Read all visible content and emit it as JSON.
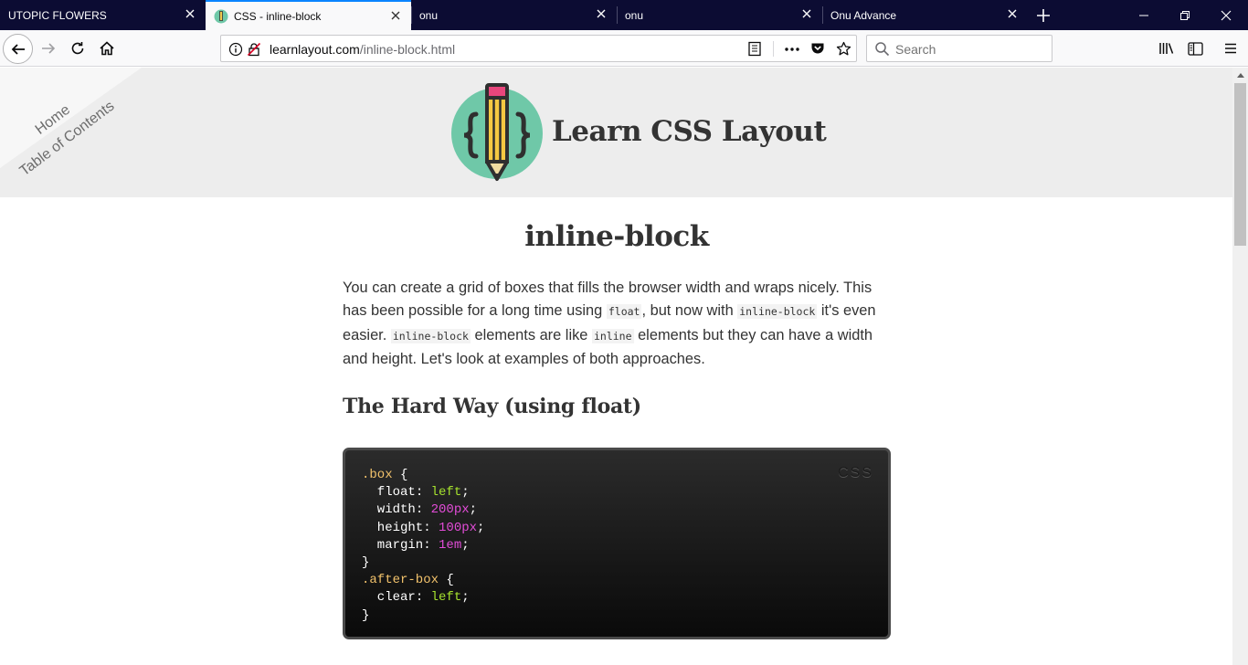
{
  "browser": {
    "tabs": [
      {
        "title": "UTOPIC FLOWERS",
        "active": false
      },
      {
        "title": "CSS - inline-block",
        "active": true
      },
      {
        "title": "onu",
        "active": false
      },
      {
        "title": "onu",
        "active": false
      },
      {
        "title": "Onu Advance",
        "active": false
      }
    ],
    "url": {
      "domain": "learnlayout.com",
      "path": "/inline-block.html"
    },
    "search_placeholder": "Search"
  },
  "site": {
    "title": "Learn CSS Layout",
    "corner_nav": [
      "Home",
      "Table of Contents"
    ]
  },
  "article": {
    "title": "inline-block",
    "intro": {
      "t1": "You can create a grid of boxes that fills the browser width and wraps nicely. This has been possible for a long time using ",
      "c1": "float",
      "t2": ", but now with ",
      "c2": "inline-block",
      "t3": " it's even easier. ",
      "c3": "inline-block",
      "t4": " elements are like ",
      "c4": "inline",
      "t5": " elements but they can have a width and height. Let's look at examples of both approaches."
    },
    "section_title": "The Hard Way (using float)",
    "code_lang": "CSS",
    "code": {
      "l1_sel": ".box",
      "l1_brace": " {",
      "l2_prop": "  float",
      "l2_val": "left",
      "l3_prop": "  width",
      "l3_val": "200px",
      "l4_prop": "  height",
      "l4_val": "100px",
      "l5_prop": "  margin",
      "l5_val": "1em",
      "l6": "}",
      "l7_sel": ".after-box",
      "l7_brace": " {",
      "l8_prop": "  clear",
      "l8_val": "left",
      "l9": "}"
    }
  },
  "colors": {
    "tabstrip": "#0c0c33",
    "active_tab_accent": "#0a84ff",
    "header_bg": "#ededed",
    "logo_circle": "#6fc8a8"
  }
}
